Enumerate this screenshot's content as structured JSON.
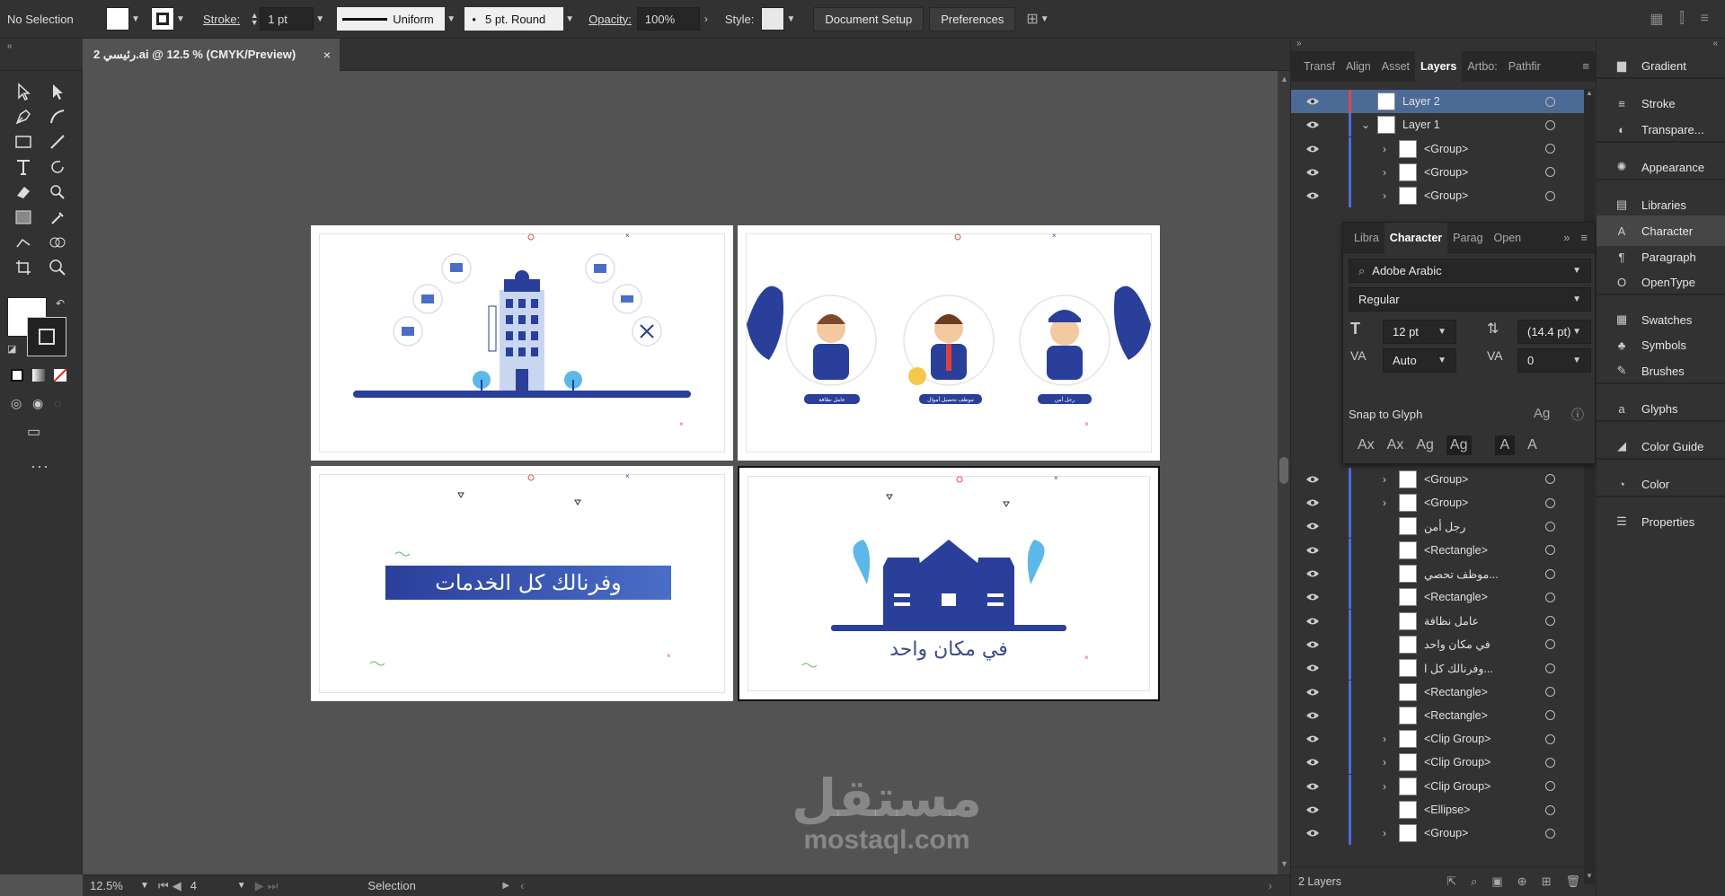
{
  "control_bar": {
    "selection": "No Selection",
    "stroke_label": "Stroke:",
    "stroke_weight": "1 pt",
    "stroke_profile": "Uniform",
    "brush": "5 pt. Round",
    "opacity_label": "Opacity:",
    "opacity_value": "100%",
    "style_label": "Style:",
    "document_setup": "Document Setup",
    "preferences": "Preferences"
  },
  "document_tab": {
    "title": "رئيسي 2.ai @ 12.5 % (CMYK/Preview)",
    "close": "×"
  },
  "status_bar": {
    "zoom": "12.5%",
    "artboard_number": "4",
    "tool": "Selection"
  },
  "artboards": {
    "slide3_text": "وفرنالك كل الخدمات",
    "slide4_text": "في مكان واحد",
    "slide2_labels": [
      "عامل نظافة",
      "موظف تحصيل أموال",
      "رجل أمن"
    ]
  },
  "watermark": {
    "arabic": "مستقل",
    "latin": "mostaql.com"
  },
  "layers_panel": {
    "tabs": [
      "Transf",
      "Align",
      "Asset",
      "Layers",
      "Artbo:",
      "Pathfir"
    ],
    "active_tab": "Layers",
    "rows": [
      {
        "name": "Layer 2",
        "indent": 0,
        "expand": "",
        "bar": "#e0454c",
        "selected": true
      },
      {
        "name": "Layer 1",
        "indent": 0,
        "expand": "v",
        "bar": "#4a6ee0",
        "selected": false
      },
      {
        "name": "<Group>",
        "indent": 1,
        "expand": ">",
        "bar": "#4a6ee0"
      },
      {
        "name": "<Group>",
        "indent": 1,
        "expand": ">",
        "bar": "#4a6ee0"
      },
      {
        "name": "<Group>",
        "indent": 1,
        "expand": ">",
        "bar": "#4a6ee0"
      },
      {
        "name": "<Group>",
        "indent": 1,
        "expand": ">",
        "bar": "#4a6ee0"
      },
      {
        "name": "<Group>",
        "indent": 1,
        "expand": ">",
        "bar": "#4a6ee0"
      },
      {
        "name": "رجل أمن",
        "indent": 1,
        "expand": "",
        "bar": "#4a6ee0"
      },
      {
        "name": "<Rectangle>",
        "indent": 1,
        "expand": "",
        "bar": "#4a6ee0"
      },
      {
        "name": "موظف تحصي...",
        "indent": 1,
        "expand": "",
        "bar": "#4a6ee0"
      },
      {
        "name": "<Rectangle>",
        "indent": 1,
        "expand": "",
        "bar": "#4a6ee0"
      },
      {
        "name": "عامل نظافة",
        "indent": 1,
        "expand": "",
        "bar": "#4a6ee0"
      },
      {
        "name": "في مكان واحد",
        "indent": 1,
        "expand": "",
        "bar": "#4a6ee0"
      },
      {
        "name": "وفرنالك كل ا...",
        "indent": 1,
        "expand": "",
        "bar": "#4a6ee0"
      },
      {
        "name": "<Rectangle>",
        "indent": 1,
        "expand": "",
        "bar": "#4a6ee0"
      },
      {
        "name": "<Rectangle>",
        "indent": 1,
        "expand": "",
        "bar": "#4a6ee0"
      },
      {
        "name": "<Clip Group>",
        "indent": 1,
        "expand": ">",
        "bar": "#4a6ee0"
      },
      {
        "name": "<Clip Group>",
        "indent": 1,
        "expand": ">",
        "bar": "#4a6ee0"
      },
      {
        "name": "<Clip Group>",
        "indent": 1,
        "expand": ">",
        "bar": "#4a6ee0"
      },
      {
        "name": "<Ellipse>",
        "indent": 1,
        "expand": "",
        "bar": "#4a6ee0"
      },
      {
        "name": "<Group>",
        "indent": 1,
        "expand": ">",
        "bar": "#4a6ee0"
      }
    ],
    "footer": "2 Layers"
  },
  "character_panel": {
    "tabs": [
      "Libra",
      "Character",
      "Parag",
      "Open"
    ],
    "active_tab": "Character",
    "font_family": "Adobe Arabic",
    "font_style": "Regular",
    "font_size": "12 pt",
    "leading": "(14.4 pt)",
    "kerning": "Auto",
    "tracking": "0",
    "snap_to_glyph": "Snap to Glyph"
  },
  "dock": [
    {
      "label": "Gradient",
      "icon": "gradient-icon"
    },
    {
      "label": "Stroke",
      "icon": "stroke-icon"
    },
    {
      "label": "Transpare...",
      "icon": "transparency-icon"
    },
    {
      "label": "Appearance",
      "icon": "appearance-icon"
    },
    {
      "label": "Libraries",
      "icon": "libraries-icon"
    },
    {
      "label": "Character",
      "icon": "character-icon"
    },
    {
      "label": "Paragraph",
      "icon": "paragraph-icon"
    },
    {
      "label": "OpenType",
      "icon": "opentype-icon"
    },
    {
      "label": "Swatches",
      "icon": "swatches-icon"
    },
    {
      "label": "Symbols",
      "icon": "symbols-icon"
    },
    {
      "label": "Brushes",
      "icon": "brushes-icon"
    },
    {
      "label": "Glyphs",
      "icon": "glyphs-icon"
    },
    {
      "label": "Color Guide",
      "icon": "color-guide-icon"
    },
    {
      "label": "Color",
      "icon": "color-icon"
    },
    {
      "label": "Properties",
      "icon": "properties-icon"
    }
  ],
  "colors": {
    "brand_blue": "#2a3f9a",
    "light_blue": "#5bb8e8",
    "layer_red": "#e0454c",
    "layer_blue": "#4a6ee0"
  }
}
